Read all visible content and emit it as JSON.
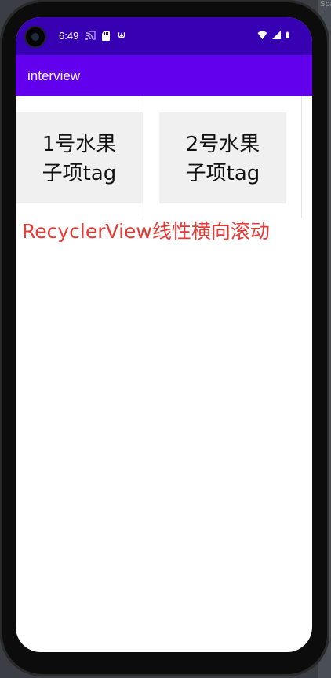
{
  "status_bar": {
    "time": "6:49",
    "left_icons": [
      "cast-icon",
      "sd-card-icon",
      "data-saver-icon"
    ],
    "right_icons": [
      "wifi-icon",
      "signal-icon",
      "battery-icon"
    ],
    "background_color": "#3700b3"
  },
  "app_bar": {
    "title": "interview",
    "background_color": "#6200ee"
  },
  "recycler": {
    "orientation": "horizontal",
    "items": [
      {
        "line1": "1号水果",
        "line2": "子项tag"
      },
      {
        "line1": "2号水果",
        "line2": "子项tag"
      }
    ]
  },
  "caption": {
    "text": "RecyclerView线性横向滚动",
    "color": "#e53935"
  },
  "background_window": {
    "text": "Spr"
  }
}
